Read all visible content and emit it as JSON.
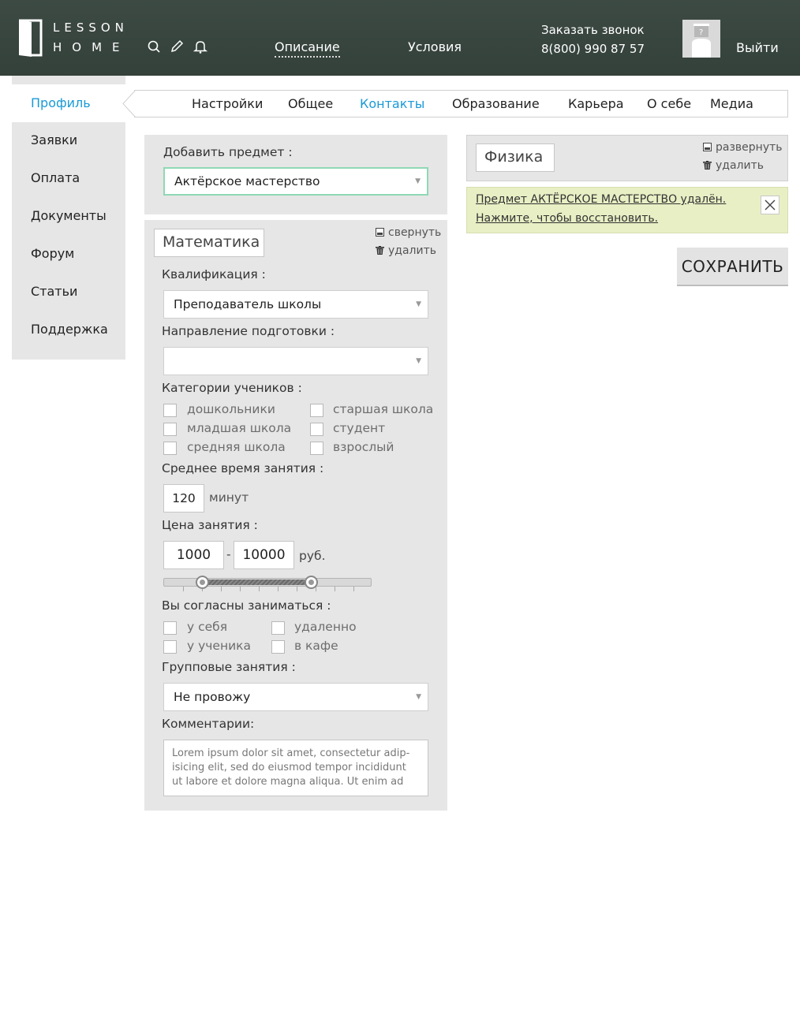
{
  "header": {
    "logo_top": "LESSON",
    "logo_bottom": "HOME",
    "nav": [
      "Описание",
      "Условия"
    ],
    "call_label": "Заказать звонок",
    "phone": "8(800) 990 87 57",
    "logout": "Выйти",
    "icons": [
      "search-icon",
      "pencil-icon",
      "bell-icon"
    ]
  },
  "sidebar": {
    "items": [
      "Профиль",
      "Заявки",
      "Оплата",
      "Документы",
      "Форум",
      "Статьи",
      "Поддержка"
    ],
    "active": 0
  },
  "tabs": {
    "items": [
      "Настройки",
      "Общее",
      "Контакты",
      "Образование",
      "Карьера",
      "О себе",
      "Медиа"
    ],
    "active": 2
  },
  "add_subject": {
    "label": "Добавить предмет :",
    "value": "Актёрское мастерство"
  },
  "math": {
    "title": "Математика",
    "collapse": "свернуть",
    "delete": "удалить",
    "qualification_label": "Квалификация :",
    "qualification_value": "Преподаватель школы",
    "direction_label": "Направление подготовки :",
    "direction_value": "",
    "categories_label": "Категории учеников :",
    "categories": [
      "дошкольники",
      "младшая школа",
      "средняя школа",
      "старшая школа",
      "студент",
      "взрослый"
    ],
    "duration_label": "Среднее время занятия :",
    "duration_value": "120",
    "duration_unit": "минут",
    "price_label": "Цена занятия :",
    "price_min": "1000",
    "price_dash": "-",
    "price_max": "10000",
    "price_unit": "руб.",
    "agree_label": "Вы согласны заниматься :",
    "locations": [
      "у себя",
      "у ученика",
      "удаленно",
      "в кафе"
    ],
    "group_label": "Групповые занятия :",
    "group_value": "Не провожу",
    "comments_label": "Комментарии:",
    "comments_value": "Lorem ipsum dolor sit amet, consectetur adip-isicing elit, sed do eiusmod tempor incididunt ut labore et dolore magna aliqua. Ut enim ad"
  },
  "physics": {
    "title": "Физика",
    "expand": "развернуть",
    "delete": "удалить"
  },
  "notice": {
    "line1": "Предмет АКТЁРСКОЕ МАСТЕРСТВО удалён.",
    "line2": "Нажмите, чтобы восстановить."
  },
  "save_button": "СОХРАНИТЬ",
  "colors": {
    "accent": "#1a9ad6",
    "header_bg": "#3a4741",
    "notice_bg": "#e8efc4",
    "panel_bg": "#e6e6e6",
    "focus_border": "#8fd8b5"
  }
}
